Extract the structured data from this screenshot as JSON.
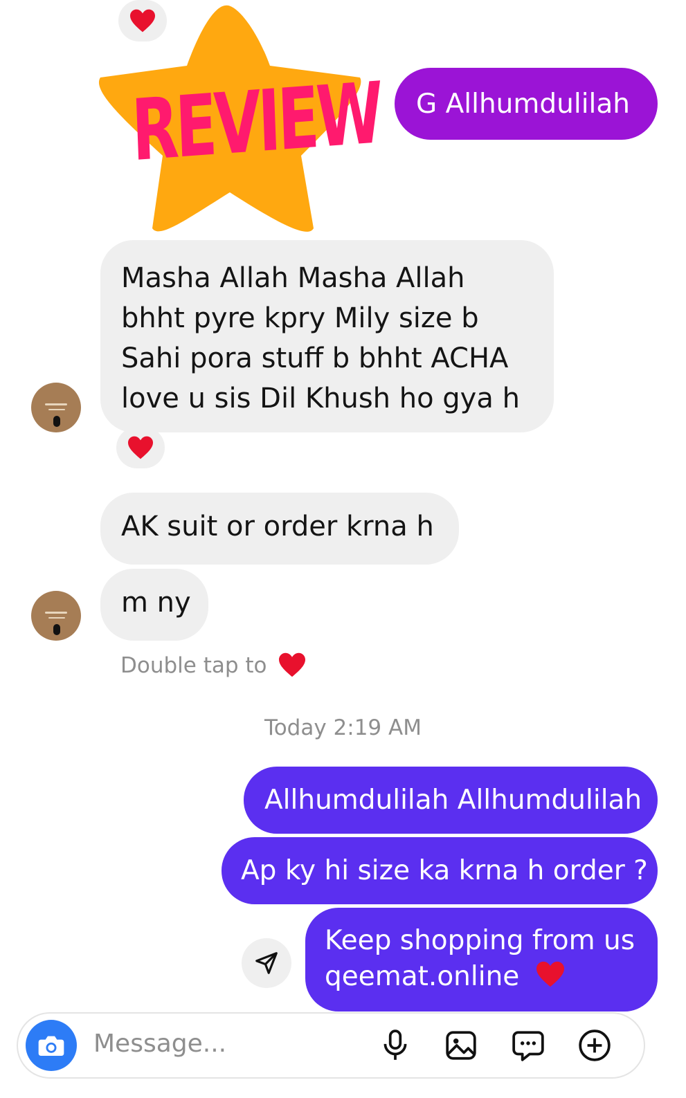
{
  "conversation": {
    "sent_top": "G Allhumdulilah",
    "sticker_text": "REVIEW",
    "received_long": [
      "Masha Allah Masha Allah",
      "bhht pyre kpry Mily size b",
      "Sahi pora stuff b bhht ACHA",
      "love u sis Dil Khush ho gya h"
    ],
    "received_order": "AK suit or order krna h",
    "received_short": "m ny",
    "double_tap_hint": "Double tap to",
    "timestamp": "Today 2:19 AM",
    "sent_1": "Allhumdulilah Allhumdulilah",
    "sent_2": "Ap ky hi size ka krna h order ?",
    "sent_3_line1": "Keep shopping from us",
    "sent_3_line2": "qeemat.online"
  },
  "composer": {
    "placeholder": "Message..."
  },
  "icons": {
    "reaction": "heart-icon",
    "send": "send-icon",
    "camera": "camera-icon",
    "mic": "microphone-icon",
    "gallery": "image-icon",
    "sticker": "chat-sticker-icon",
    "add": "plus-icon"
  },
  "colors": {
    "sent_purple": "#9b14d6",
    "sent_blue": "#5b2ff0",
    "received_bg": "#efefef",
    "heart": "#e8112d",
    "sticker_star": "#ffa810",
    "sticker_text": "#ff1a6e",
    "camera_blue": "#2d7cf6"
  }
}
